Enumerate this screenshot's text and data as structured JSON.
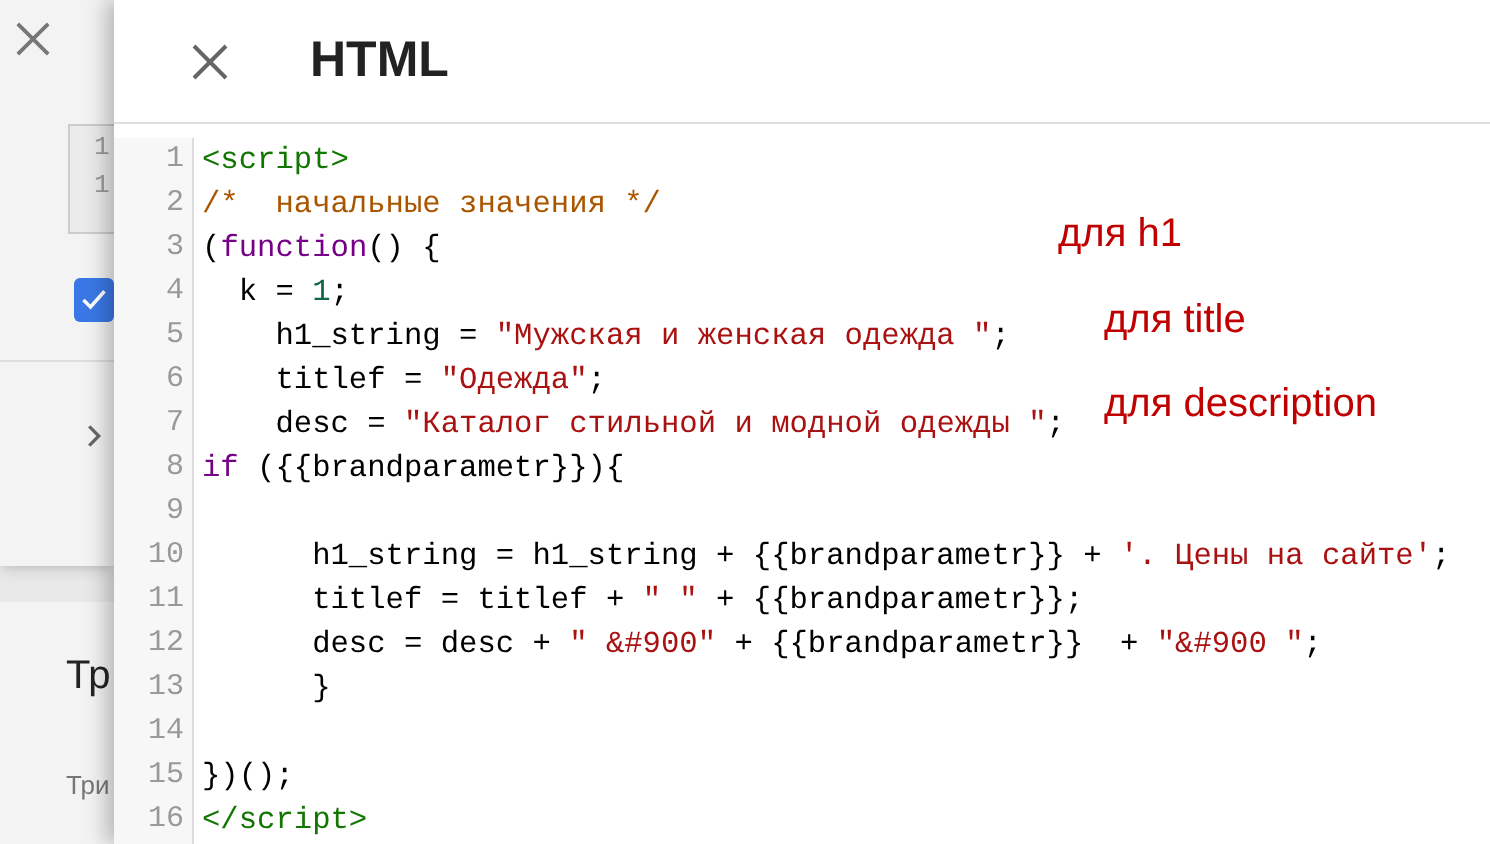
{
  "background_panel": {
    "line_numbers": [
      "1",
      "1"
    ],
    "checkbox": {
      "checked": true
    },
    "heading": "Тр",
    "subtext": "Три"
  },
  "dialog": {
    "title": "HTML",
    "code_lines": [
      {
        "number": "1",
        "tokens": [
          {
            "text": "<script>",
            "kind": "tag"
          }
        ]
      },
      {
        "number": "2",
        "tokens": [
          {
            "text": "/*  начальные значения */",
            "kind": "comment"
          }
        ]
      },
      {
        "number": "3",
        "tokens": [
          {
            "text": "(",
            "kind": "plain"
          },
          {
            "text": "function",
            "kind": "keyword"
          },
          {
            "text": "() {",
            "kind": "plain"
          }
        ]
      },
      {
        "number": "4",
        "tokens": [
          {
            "text": "  k = ",
            "kind": "plain"
          },
          {
            "text": "1",
            "kind": "number"
          },
          {
            "text": ";",
            "kind": "plain"
          }
        ]
      },
      {
        "number": "5",
        "tokens": [
          {
            "text": "    h1_string = ",
            "kind": "plain"
          },
          {
            "text": "\"Мужская и женская одежда \"",
            "kind": "string"
          },
          {
            "text": ";",
            "kind": "plain"
          }
        ]
      },
      {
        "number": "6",
        "tokens": [
          {
            "text": "    titlef = ",
            "kind": "plain"
          },
          {
            "text": "\"Одежда\"",
            "kind": "string"
          },
          {
            "text": ";",
            "kind": "plain"
          }
        ]
      },
      {
        "number": "7",
        "tokens": [
          {
            "text": "    desc = ",
            "kind": "plain"
          },
          {
            "text": "\"Каталог стильной и модной одежды \"",
            "kind": "string"
          },
          {
            "text": ";",
            "kind": "plain"
          }
        ]
      },
      {
        "number": "8",
        "tokens": [
          {
            "text": "if",
            "kind": "keyword"
          },
          {
            "text": " ({{brandparametr}}){",
            "kind": "plain"
          }
        ]
      },
      {
        "number": "9"
      },
      {
        "number": "10",
        "tokens": [
          {
            "text": "      h1_string = h1_string + {{brandparametr}} + ",
            "kind": "plain"
          },
          {
            "text": "'. Цены на сайте'",
            "kind": "string"
          },
          {
            "text": ";",
            "kind": "plain"
          }
        ]
      },
      {
        "number": "11",
        "tokens": [
          {
            "text": "      titlef = titlef + ",
            "kind": "plain"
          },
          {
            "text": "\" \"",
            "kind": "string"
          },
          {
            "text": " + {{brandparametr}};",
            "kind": "plain"
          }
        ]
      },
      {
        "number": "12",
        "tokens": [
          {
            "text": "      desc = desc + ",
            "kind": "plain"
          },
          {
            "text": "\" &#900\"",
            "kind": "string"
          },
          {
            "text": " + {{brandparametr}}  + ",
            "kind": "plain"
          },
          {
            "text": "\"&#900 \"",
            "kind": "string"
          },
          {
            "text": ";",
            "kind": "plain"
          }
        ]
      },
      {
        "number": "13",
        "tokens": [
          {
            "text": "      }",
            "kind": "plain"
          }
        ]
      },
      {
        "number": "14"
      },
      {
        "number": "15",
        "tokens": [
          {
            "text": "})();",
            "kind": "plain"
          }
        ]
      },
      {
        "number": "16",
        "tokens": [
          {
            "text": "</script>",
            "kind": "tag"
          }
        ]
      }
    ],
    "annotations": [
      {
        "text": "для h1"
      },
      {
        "text": "для title"
      },
      {
        "text": "для description"
      }
    ]
  }
}
